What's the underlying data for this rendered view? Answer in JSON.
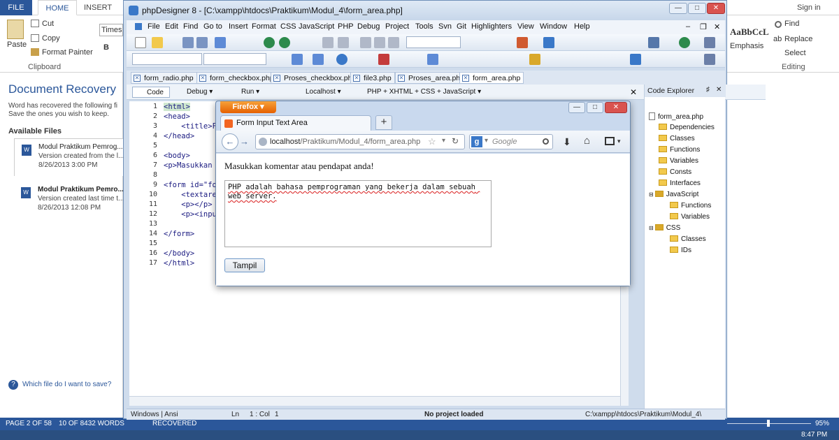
{
  "word": {
    "tabs": {
      "file": "FILE",
      "home": "HOME",
      "insert": "INSERT"
    },
    "signin": "Sign in",
    "clipboard": {
      "cut": "Cut",
      "copy": "Copy",
      "paste": "Paste",
      "format_painter": "Format Painter",
      "group": "Clipboard"
    },
    "font_box": "Times",
    "styles_sample": "AaBbCcL",
    "emphasis": "Emphasis",
    "editing": {
      "find": "Find",
      "replace": "Replace",
      "select": "Select",
      "group": "Editing"
    },
    "recovery": {
      "title": "Document Recovery",
      "desc1": "Word has recovered the following fi",
      "desc2": "Save the ones you wish to keep.",
      "available": "Available Files",
      "files": [
        {
          "name": "Modul Praktikum Pemrog...",
          "line2": "Version created from the l...",
          "date": "8/26/2013 3:00 PM"
        },
        {
          "name": "Modul Praktikum Pemro...",
          "line2": "Version created last time t...",
          "date": "8/26/2013 12:08 PM"
        }
      ],
      "help": "Which file do I want to save?"
    },
    "status": {
      "page": "PAGE 2 OF 58",
      "words": "10 OF 8432 WORDS",
      "recovered": "RECOVERED",
      "zoom": "95%"
    },
    "clock": "8:47 PM"
  },
  "pd": {
    "title": "phpDesigner 8 - [C:\\xampp\\htdocs\\Praktikum\\Modul_4\\form_area.php]",
    "menu": [
      "File",
      "Edit",
      "Find",
      "Go to",
      "Insert",
      "Format",
      "CSS",
      "JavaScript",
      "PHP",
      "Debug",
      "Project",
      "Tools",
      "Svn",
      "Git",
      "Highlighters",
      "View",
      "Window",
      "Help"
    ],
    "file_tabs": [
      "form_radio.php",
      "form_checkbox.php",
      "Proses_checkbox.php",
      "file3.php",
      "Proses_area.php",
      "form_area.php"
    ],
    "subtools": {
      "code": "Code",
      "debug": "Debug",
      "run": "Run",
      "localhost": "Localhost",
      "mode": "PHP + XHTML + CSS + JavaScript"
    },
    "code_lines": [
      {
        "n": "1",
        "t": "<html>"
      },
      {
        "n": "2",
        "t": "<head>"
      },
      {
        "n": "3",
        "t": "    <title>F"
      },
      {
        "n": "4",
        "t": "</head>"
      },
      {
        "n": "5",
        "t": ""
      },
      {
        "n": "6",
        "t": "<body>"
      },
      {
        "n": "7",
        "t": "<p>Masukkan"
      },
      {
        "n": "8",
        "t": ""
      },
      {
        "n": "9",
        "t": "<form id=\"fo"
      },
      {
        "n": "10",
        "t": "    <textare"
      },
      {
        "n": "11",
        "t": "    <p></p>"
      },
      {
        "n": "12",
        "t": "    <p><inpu"
      },
      {
        "n": "13",
        "t": ""
      },
      {
        "n": "14",
        "t": "</form>"
      },
      {
        "n": "15",
        "t": ""
      },
      {
        "n": "16",
        "t": "</body>"
      },
      {
        "n": "17",
        "t": "</html>"
      }
    ],
    "code_explorer": {
      "title": "Code Explorer",
      "file": "form_area.php",
      "items": [
        {
          "label": "Dependencies",
          "indent": 1
        },
        {
          "label": "Classes",
          "indent": 1
        },
        {
          "label": "Functions",
          "indent": 1
        },
        {
          "label": "Variables",
          "indent": 1
        },
        {
          "label": "Consts",
          "indent": 1
        },
        {
          "label": "Interfaces",
          "indent": 1
        },
        {
          "label": "JavaScript",
          "indent": 1
        },
        {
          "label": "Functions",
          "indent": 2
        },
        {
          "label": "Variables",
          "indent": 2
        },
        {
          "label": "CSS",
          "indent": 1
        },
        {
          "label": "Classes",
          "indent": 2
        },
        {
          "label": "IDs",
          "indent": 2
        }
      ]
    },
    "status": {
      "encoding": "Windows | Ansi",
      "ln": "Ln",
      "pos": "1 : Col",
      "col": "1",
      "project": "No project loaded",
      "path": "C:\\xampp\\htdocs\\Praktikum\\Modul_4\\"
    }
  },
  "ff": {
    "button": "Firefox",
    "tab_title": "Form Input Text Area",
    "url_host": "localhost",
    "url_path": "/Praktikum/Modul_4/form_area.php",
    "search_placeholder": "Google",
    "heading": "Masukkan komentar atau pendapat anda!",
    "textarea": "PHP adalah bahasa pemprograman yang bekerja dalam sebuah web server.",
    "submit": "Tampil"
  }
}
